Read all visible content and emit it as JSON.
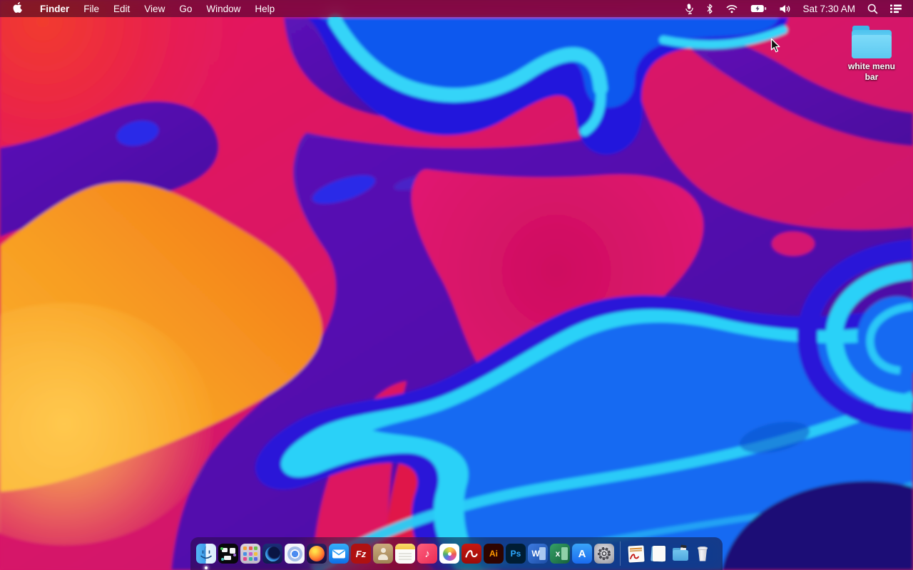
{
  "menu_bar": {
    "app_name": "Finder",
    "menus": [
      "File",
      "Edit",
      "View",
      "Go",
      "Window",
      "Help"
    ],
    "status_icons": [
      "microphone",
      "bluetooth",
      "wifi",
      "battery-charging",
      "volume"
    ],
    "clock": "Sat 7:30 AM",
    "right_icons": [
      "spotlight-search",
      "notification-center"
    ]
  },
  "desktop": {
    "folder_icon_label": "white menu bar",
    "cursor": "arrow"
  },
  "dock": {
    "items": [
      "finder",
      "mission-control",
      "launchpad",
      "firefox-nightly",
      "chromium",
      "firefox",
      "mail",
      "filezilla",
      "contacts",
      "notes",
      "music",
      "photos",
      "acrobat-reader",
      "illustrator",
      "photoshop",
      "word",
      "excel",
      "app-store",
      "system-preferences",
      "separator",
      "pdf-documents-stack",
      "documents-stack",
      "downloads-folder",
      "trash"
    ],
    "labels": {
      "filezilla": "Fz",
      "illustrator": "Ai",
      "photoshop": "Ps",
      "word": "W",
      "excel": "x",
      "music_note": "♪",
      "app_store": "A"
    },
    "finder_running": true
  },
  "wallpaper": {
    "style": "abstract-fluid",
    "palette": {
      "magenta": "#D81468",
      "crimson": "#E01448",
      "orange": "#F89E22",
      "yellow_orange": "#FBB637",
      "purple": "#5212A8",
      "royal_blue": "#2B18D8",
      "azure": "#156AF2",
      "cyan": "#2BD1F8",
      "indigo": "#1C1176",
      "red": "#E8253C"
    }
  }
}
